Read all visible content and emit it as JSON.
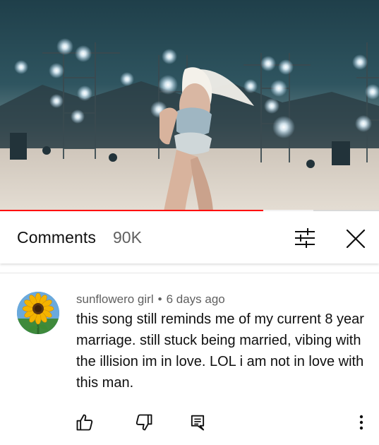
{
  "video": {
    "progress_fraction": 0.695,
    "buffered_fraction": 0.827
  },
  "comments_panel": {
    "title": "Comments",
    "count": "90K",
    "filter_icon": "sliders-icon",
    "close_icon": "close-icon"
  },
  "comment": {
    "author": "sunflowero girl",
    "separator": "•",
    "time": "6 days ago",
    "text": "this song still reminds me of my current 8 year marriage. still stuck being married, vibing with the illision im in love. LOL i am not in love with this man.",
    "avatar_icon": "sunflower-avatar",
    "actions": {
      "like_icon": "thumbs-up-icon",
      "dislike_icon": "thumbs-down-icon",
      "reply_icon": "reply-icon",
      "more_icon": "more-vert-icon"
    }
  },
  "colors": {
    "accent": "#ff0000",
    "secondary_text": "#606060",
    "primary_text": "#0f0f0f"
  }
}
